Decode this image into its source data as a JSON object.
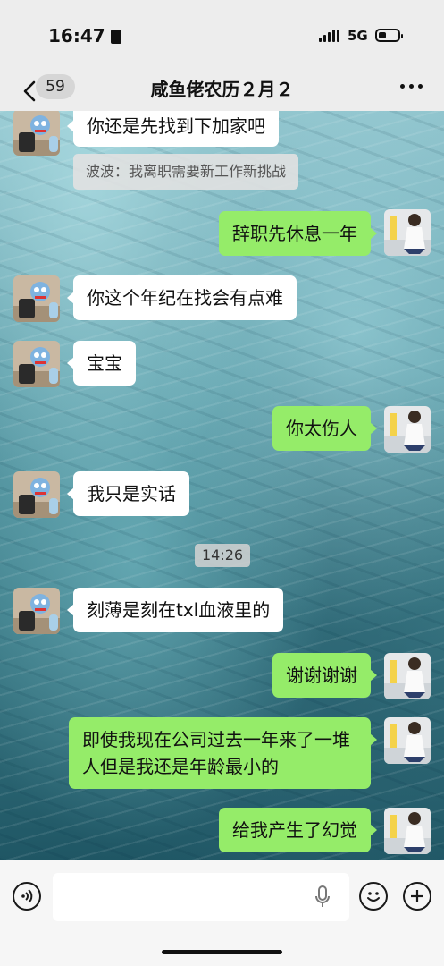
{
  "status_bar": {
    "time": "16:47",
    "network": "5G"
  },
  "nav": {
    "unread_count": "59",
    "title": "咸鱼佬农历２月２"
  },
  "messages": [
    {
      "side": "in",
      "text": "你还是先找到下加家吧"
    },
    {
      "side": "quote",
      "text": "波波：我离职需要新工作新挑战"
    },
    {
      "side": "out",
      "text": "辞职先休息一年"
    },
    {
      "side": "in",
      "text": "你这个年纪在找会有点难"
    },
    {
      "side": "in",
      "text": "宝宝"
    },
    {
      "side": "out",
      "text": "你太伤人"
    },
    {
      "side": "in",
      "text": "我只是实话"
    },
    {
      "side": "time",
      "text": "14:26"
    },
    {
      "side": "in",
      "text": "刻薄是刻在txl血液里的"
    },
    {
      "side": "out",
      "text": "谢谢谢谢"
    },
    {
      "side": "out",
      "text": "即使我现在公司过去一年来了一堆人但是我还是年龄最小的"
    },
    {
      "side": "out",
      "text": "给我产生了幻觉"
    }
  ],
  "input_bar": {
    "placeholder": ""
  },
  "colors": {
    "outgoing_bubble": "#95ec69",
    "incoming_bubble": "#ffffff",
    "bar": "#ededed"
  }
}
